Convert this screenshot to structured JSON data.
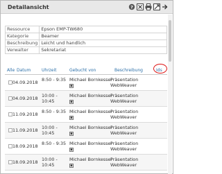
{
  "window": {
    "title": "Detailansicht",
    "icons": [
      "help-icon",
      "close-icon",
      "print-icon",
      "export-icon",
      "forward-icon"
    ]
  },
  "details": [
    {
      "label": "Ressource",
      "value": "Epson EMP-TW680"
    },
    {
      "label": "Kategorie",
      "value": "Beamer"
    },
    {
      "label": "Beschreibung",
      "value": "Leicht und handlich"
    },
    {
      "label": "Verwalter",
      "value": "Sekretariat"
    }
  ],
  "table": {
    "headers": {
      "all": "Alle",
      "date": "Datum",
      "time": "Uhrzeit",
      "booked_by": "Gebucht von",
      "description": "Beschreibung",
      "ids": "Ids"
    },
    "rows": [
      {
        "date": "04.09.2018",
        "time": "8:50 - 9:35",
        "time2": "",
        "person": "Michael Bornkessel",
        "desc1": "Präsentation",
        "desc2": "WebWeaver"
      },
      {
        "date": "04.09.2018",
        "time": "10:00 -",
        "time2": "10:45",
        "person": "Michael Bornkessel",
        "desc1": "Präsentation",
        "desc2": "WebWeaver"
      },
      {
        "date": "11.09.2018",
        "time": "8:50 - 9:35",
        "time2": "",
        "person": "Michael Bornkessel",
        "desc1": "Präsentation",
        "desc2": "WebWeaver"
      },
      {
        "date": "11.09.2018",
        "time": "10:00 -",
        "time2": "10:45",
        "person": "Michael Bornkessel",
        "desc1": "Präsentation",
        "desc2": "WebWeaver"
      },
      {
        "date": "18.09.2018",
        "time": "8:50 - 9:35",
        "time2": "",
        "person": "Michael Bornkessel",
        "desc1": "Präsentation",
        "desc2": "WebWeaver"
      },
      {
        "date": "18.09.2018",
        "time": "10:00 -",
        "time2": "10:45",
        "person": "Michael Bornkessel",
        "desc1": "Präsentation",
        "desc2": "WebWeaver"
      }
    ]
  },
  "colors": {
    "link": "#2b6fa8",
    "highlight": "#dd1111"
  }
}
